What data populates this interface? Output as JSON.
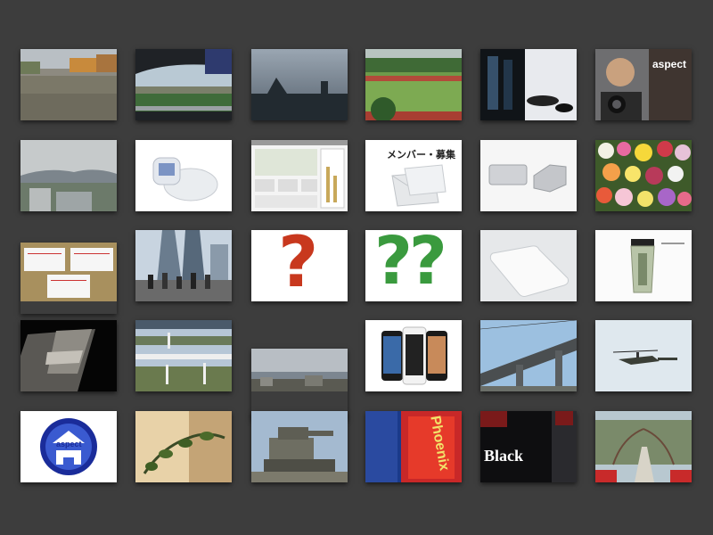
{
  "gallery": {
    "thumbnails": [
      {
        "name": "flooded-street-thumbnail"
      },
      {
        "name": "car-window-view-thumbnail"
      },
      {
        "name": "cloudy-sky-silhouette-thumbnail"
      },
      {
        "name": "soccer-field-thumbnail"
      },
      {
        "name": "glass-objects-thumbnail"
      },
      {
        "name": "aspect-photographer-thumbnail",
        "text": "aspect"
      },
      {
        "name": "city-mountains-thumbnail"
      },
      {
        "name": "white-device-thumbnail"
      },
      {
        "name": "website-screenshot-thumbnail"
      },
      {
        "name": "member-recruitment-envelope-thumbnail",
        "text": "メンバー・募集"
      },
      {
        "name": "silver-drives-thumbnail"
      },
      {
        "name": "flower-bouquet-thumbnail"
      },
      {
        "name": "calendar-on-board-thumbnail"
      },
      {
        "name": "skyscrapers-crowd-thumbnail"
      },
      {
        "name": "red-question-mark-thumbnail",
        "text": "?"
      },
      {
        "name": "green-question-marks-thumbnail",
        "text": "??"
      },
      {
        "name": "white-iphone-back-thumbnail"
      },
      {
        "name": "tumbler-cup-thumbnail"
      },
      {
        "name": "light-on-floor-thumbnail"
      },
      {
        "name": "bridge-landscape-collage-thumbnail"
      },
      {
        "name": "cloudy-town-panorama-thumbnail"
      },
      {
        "name": "iphone-4s-lineup-thumbnail"
      },
      {
        "name": "elevated-railway-thumbnail"
      },
      {
        "name": "helicopter-sky-thumbnail"
      },
      {
        "name": "aspect-h-logo-thumbnail",
        "text": "aspect"
      },
      {
        "name": "houseplant-thumbnail"
      },
      {
        "name": "tank-monument-thumbnail"
      },
      {
        "name": "phoenix-shop-sign-thumbnail",
        "text": "Phoenix"
      },
      {
        "name": "tullys-coffee-black-sign-thumbnail",
        "text": "Black"
      },
      {
        "name": "garden-path-thumbnail"
      }
    ]
  }
}
